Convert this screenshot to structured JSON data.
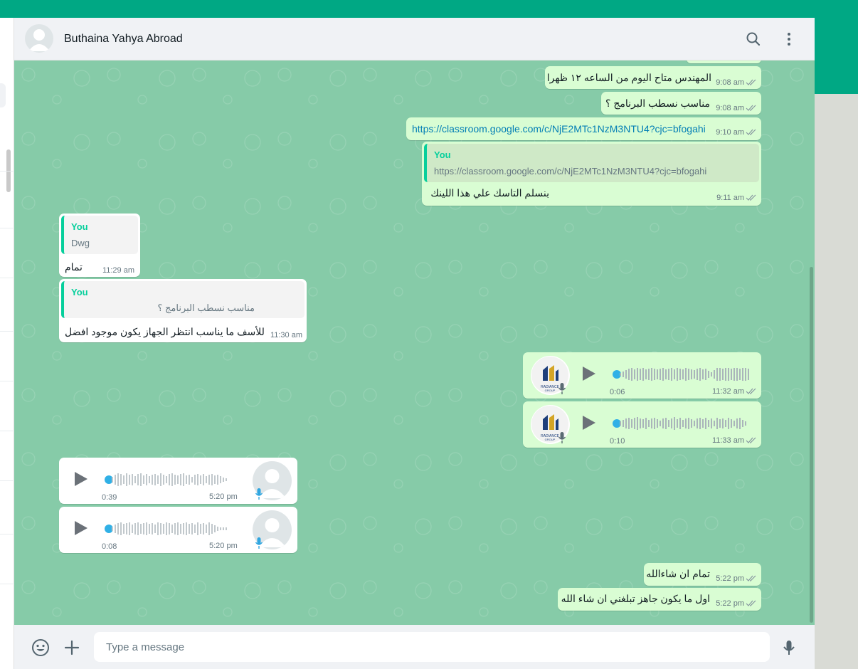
{
  "contact": {
    "name": "Buthaina Yahya Abroad"
  },
  "header_icons": [
    "search-icon",
    "kebab-menu-icon"
  ],
  "messages": {
    "m1": {
      "text": "المهندس متاح اليوم من الساعه ١٢ ظهرا",
      "time": "9:08 am"
    },
    "m2": {
      "text": "مناسب نسطب البرنامج ؟",
      "time": "9:08 am"
    },
    "m3": {
      "link": "https://classroom.google.com/c/NjE2MTc1NzM3NTU4?cjc=bfogahi",
      "time": "9:10 am"
    },
    "m4": {
      "quote_author": "You",
      "quote_body": "https://classroom.google.com/c/NjE2MTc1NzM3NTU4?cjc=bfogahi",
      "text": "بنسلم التاسك علي هذا اللينك",
      "time": "9:11 am"
    },
    "m5": {
      "quote_author": "You",
      "quote_body": "Dwg",
      "text": "تمام",
      "time": "11:29 am"
    },
    "m6": {
      "quote_author": "You",
      "quote_body": "مناسب نسطب البرنامج ؟",
      "text": "للأسف ما يناسب انتظر الجهاز يكون موجود افضل",
      "time": "11:30 am"
    },
    "v1": {
      "duration": "0:06",
      "time": "11:32 am"
    },
    "v2": {
      "duration": "0:10",
      "time": "11:33 am"
    },
    "v3": {
      "duration": "0:39",
      "time": "5:20 pm"
    },
    "v4": {
      "duration": "0:08",
      "time": "5:20 pm"
    },
    "m7": {
      "text": "تمام ان شاءالله",
      "time": "5:22 pm"
    },
    "m8": {
      "text": "اول ما يكون جاهز تبلغني ان شاء الله",
      "time": "5:22 pm"
    }
  },
  "logo_text": "RADIANCE GROUP",
  "composer": {
    "placeholder": "Type a message"
  },
  "colors": {
    "accent": "#00a884",
    "outgoing": "#d9fdd3",
    "incoming": "#ffffff",
    "chat_bg": "#86cba8",
    "link": "#027eb5"
  }
}
